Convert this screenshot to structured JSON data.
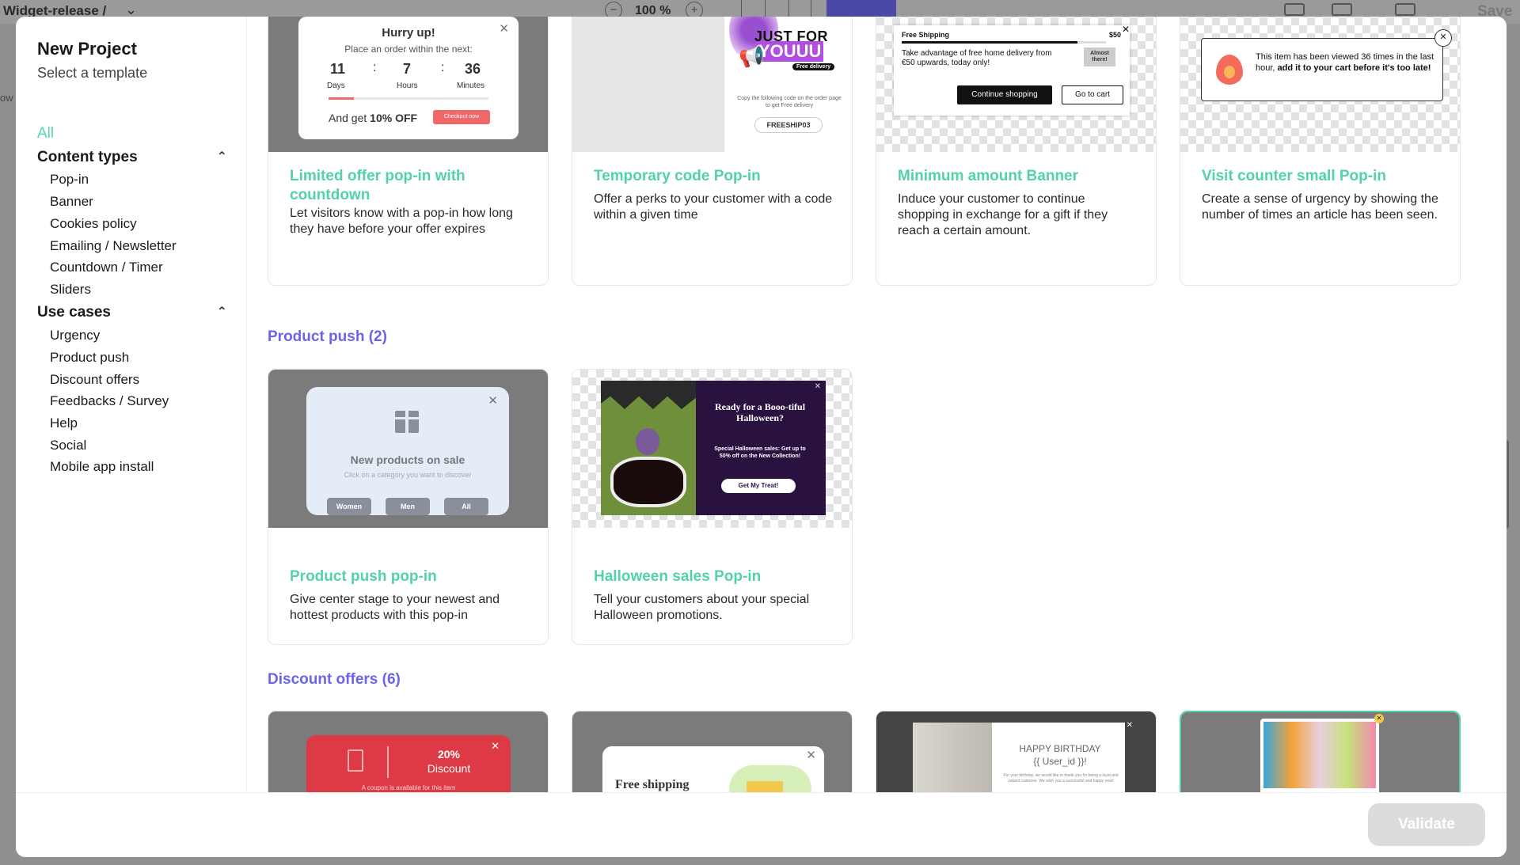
{
  "app": {
    "project_name": "Widget-release /",
    "zoom": "100 %",
    "save_label": "Save",
    "side_fragment": "ow"
  },
  "modal": {
    "title": "New Project",
    "subtitle": "Select a template"
  },
  "sidebar": {
    "all_label": "All",
    "content_types": {
      "label": "Content types",
      "items": [
        "Pop-in",
        "Banner",
        "Cookies policy",
        "Emailing / Newsletter",
        "Countdown / Timer",
        "Sliders"
      ]
    },
    "use_cases": {
      "label": "Use cases",
      "items": [
        "Urgency",
        "Product push",
        "Discount offers",
        "Feedbacks / Survey",
        "Help",
        "Social",
        "Mobile app install"
      ]
    }
  },
  "templates_top": [
    {
      "title": "Limited offer pop-in with countdown",
      "description": "Let visitors know with a pop-in how long they have before your offer expires"
    },
    {
      "title": "Temporary code Pop-in",
      "description": "Offer a perks to your customer with a code within a given time"
    },
    {
      "title": "Minimum amount Banner",
      "description": "Induce your customer to continue shopping in exchange for a gift if they reach a certain amount."
    },
    {
      "title": "Visit counter small Pop-in",
      "description": "Create a sense of urgency by showing the number of times an article has been seen."
    }
  ],
  "thumb1": {
    "heading": "Hurry up!",
    "sub": "Place an order within the next:",
    "days_val": "11",
    "hours_val": "7",
    "minutes_val": "36",
    "days": "Days",
    "hours": "Hours",
    "minutes": "Minutes",
    "sep": ":",
    "offer_prefix": "And get ",
    "offer_bold": "10% OFF",
    "cta": "Checkout now"
  },
  "thumb2": {
    "line1": "JUST FOR",
    "line2": "YOUUU",
    "badge": "Free delivery",
    "copy_text": "Copy the following code on the order page to get Free delivery",
    "code": "FREESHIP03"
  },
  "thumb3": {
    "label": "Free Shipping",
    "amount": "$50",
    "text": "Take advantage of free home delivery from €50 upwards, today only!",
    "almost": "Almost there!",
    "btn1": "Continue shopping",
    "btn2": "Go to cart"
  },
  "thumb4": {
    "text_plain": "This item has been viewed 36 times in the last hour,",
    "text_bold": " add it to your cart before it's too late!"
  },
  "sections": {
    "product_push": "Product push (2)",
    "discount_offers": "Discount offers (6)"
  },
  "templates_product": [
    {
      "title": "Product push pop-in",
      "description": "Give center stage to your newest and hottest products with this pop-in"
    },
    {
      "title": "Halloween sales Pop-in",
      "description": "Tell your customers about your special Halloween promotions."
    }
  ],
  "thumb5": {
    "heading": "New products on sale",
    "sub": "Click on a category you want to discover",
    "btn_women": "Women",
    "btn_men": "Men",
    "btn_all": "All"
  },
  "thumb6": {
    "heading": "Ready for a Booo-tiful Halloween?",
    "sub": "Special Halloween sales: Get up to 50% off on the New Collection!",
    "cta": "Get My Treat!"
  },
  "thumb7": {
    "pct": "20%",
    "label": "Discount",
    "small": "A coupon is available for this item"
  },
  "thumb8": {
    "text": "Free shipping"
  },
  "thumb9": {
    "title": "HAPPY BIRTHDAY",
    "user": "{{ User_id }}!",
    "small": "For your birthday, we would like to thank you for being a loyal and valued customer. We wish you a successful and happy year!"
  },
  "footer": {
    "validate_label": "Validate"
  },
  "colors": {
    "accent_green": "#52d2a6",
    "section_purple": "#6b64ea",
    "cta_red": "#f06868"
  }
}
